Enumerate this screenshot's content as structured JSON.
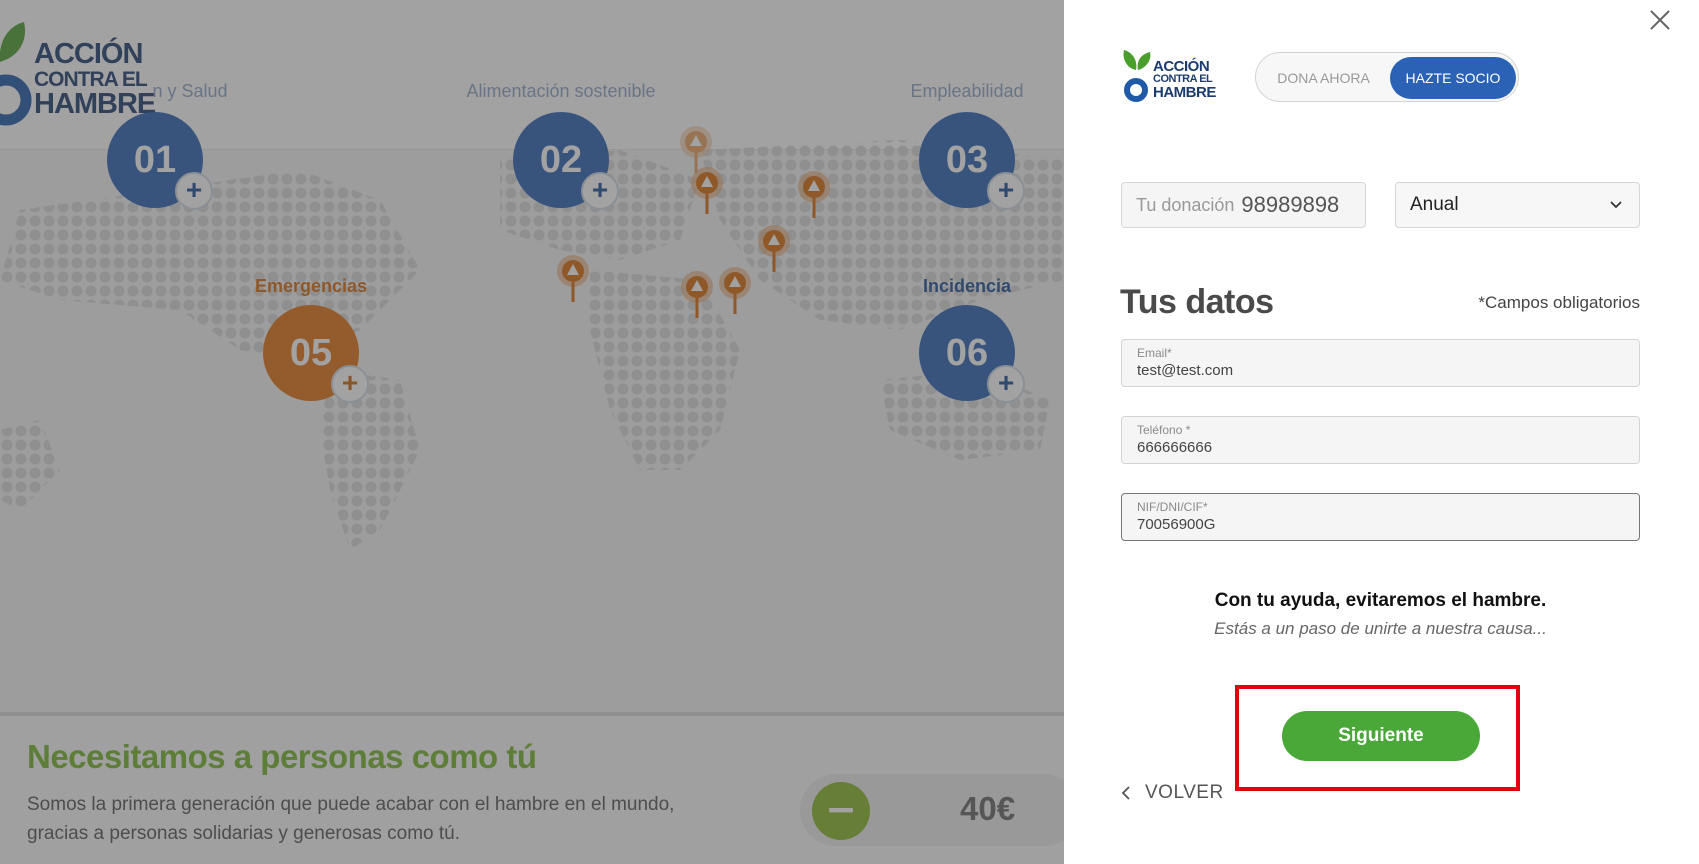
{
  "background": {
    "categories": [
      {
        "num": "01",
        "label": "n y Salud"
      },
      {
        "num": "02",
        "label": "Alimentación sostenible"
      },
      {
        "num": "03",
        "label": "Empleabilidad"
      },
      {
        "num": "05",
        "label": "Emergencias"
      },
      {
        "num": "06",
        "label": "Incidencia"
      }
    ],
    "banner": {
      "heading": "Necesitamos a personas como tú",
      "text": "Somos la primera generación que puede acabar con el hambre en el mundo, gracias a personas solidarias y generosas como tú.",
      "amount": "40€"
    },
    "logo": {
      "line1": "ACCIÓN",
      "line2": "CONTRA EL",
      "line3": "HAMBRE"
    }
  },
  "panel": {
    "logo": {
      "line1": "ACCIÓN",
      "line2": "CONTRA EL",
      "line3": "HAMBRE"
    },
    "toggle": {
      "option1": "DONA AHORA",
      "option2": "HAZTE SOCIO",
      "selected": "HAZTE SOCIO"
    },
    "donation": {
      "label": "Tu donación",
      "value": "98989898"
    },
    "frequency": {
      "value": "Anual"
    },
    "section_title": "Tus datos",
    "required_note": "*Campos obligatorios",
    "fields": {
      "email": {
        "label": "Email*",
        "value": "test@test.com"
      },
      "phone": {
        "label": "Teléfono *",
        "value": "666666666"
      },
      "nif": {
        "label": "NIF/DNI/CIF*",
        "value": "70056900G"
      }
    },
    "help_title": "Con tu ayuda, evitaremos el hambre.",
    "help_sub": "Estás a un paso de unirte a nuestra causa...",
    "next_label": "Siguiente",
    "back_label": "VOLVER"
  },
  "colors": {
    "brand_blue": "#2b62b6",
    "brand_green": "#4aa838",
    "highlight_red": "#e3000f",
    "emergency_orange": "#e27212"
  },
  "icons": [
    "close-icon",
    "chevron-down-icon",
    "chevron-left-icon",
    "plus-icon",
    "warning-pin-icon",
    "minus-icon",
    "logo-leaf-icon"
  ]
}
